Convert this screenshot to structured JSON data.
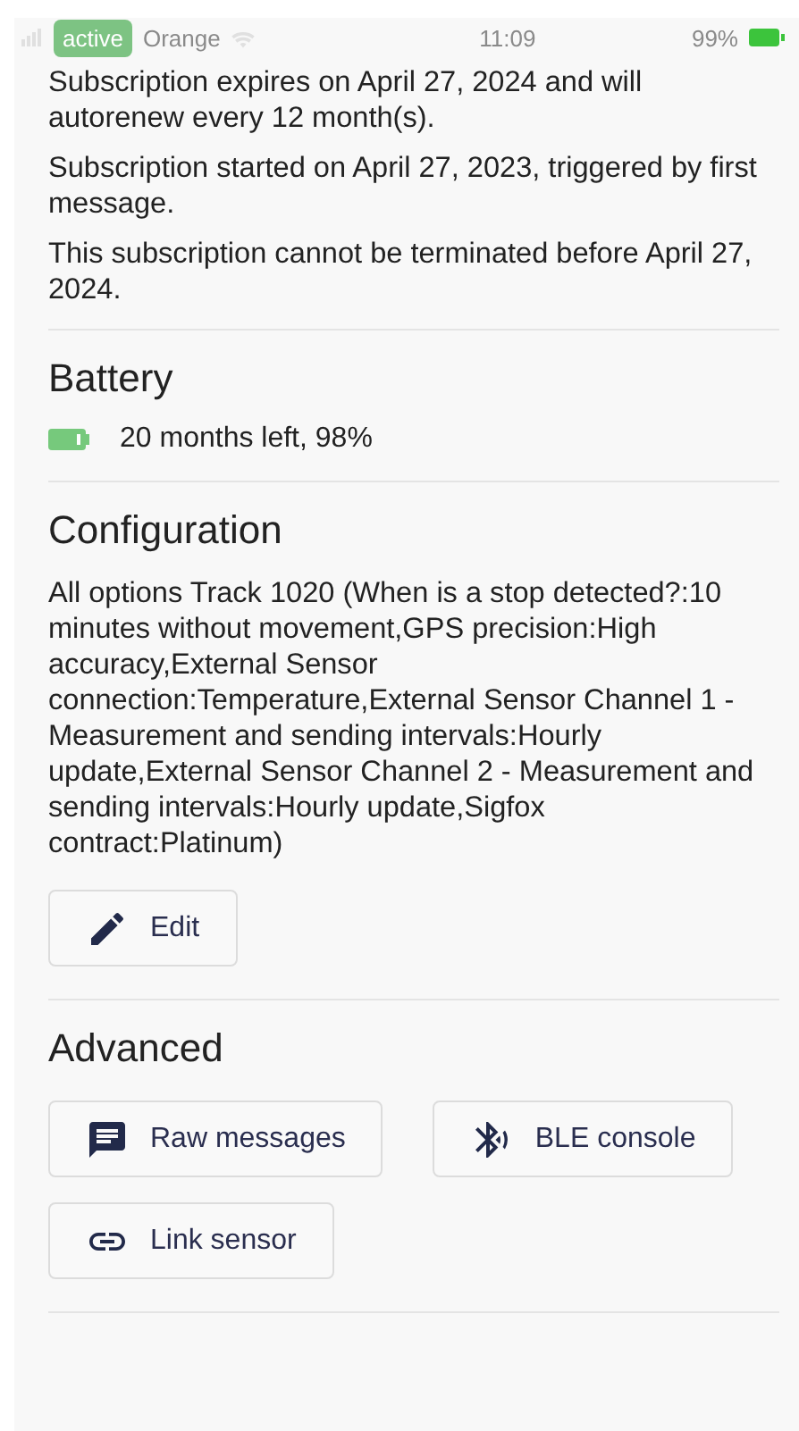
{
  "status_bar": {
    "carrier": "Orange",
    "time": "11:09",
    "battery": "99%"
  },
  "badge": {
    "label": "active"
  },
  "subscription": {
    "lines": [
      "Subscription expires on April 27, 2024 and will autorenew every 12 month(s).",
      "Subscription started on April 27, 2023, triggered by first message.",
      "This subscription cannot be terminated before April 27, 2024."
    ]
  },
  "sections": [
    {
      "kind": "battery",
      "title": "Battery",
      "text": "20 months left, 98%"
    },
    {
      "kind": "text",
      "title": "Configuration",
      "text": "All options Track 1020 (When is a stop detected?:10 minutes without movement,GPS precision:High accuracy,External Sensor connection:Temperature,External Sensor Channel 1 - Measurement and sending intervals:Hourly update,External Sensor Channel 2 - Measurement and sending intervals:Hourly update,Sigfox contract:Platinum)",
      "buttons": [
        {
          "kind": "pencil",
          "label": "Edit"
        }
      ]
    },
    {
      "kind": "text",
      "title": "Advanced",
      "buttons": [
        {
          "kind": "message",
          "label": "Raw messages"
        },
        {
          "kind": "bluetooth",
          "label": "BLE console"
        },
        {
          "kind": "link",
          "label": "Link sensor"
        }
      ]
    }
  ]
}
